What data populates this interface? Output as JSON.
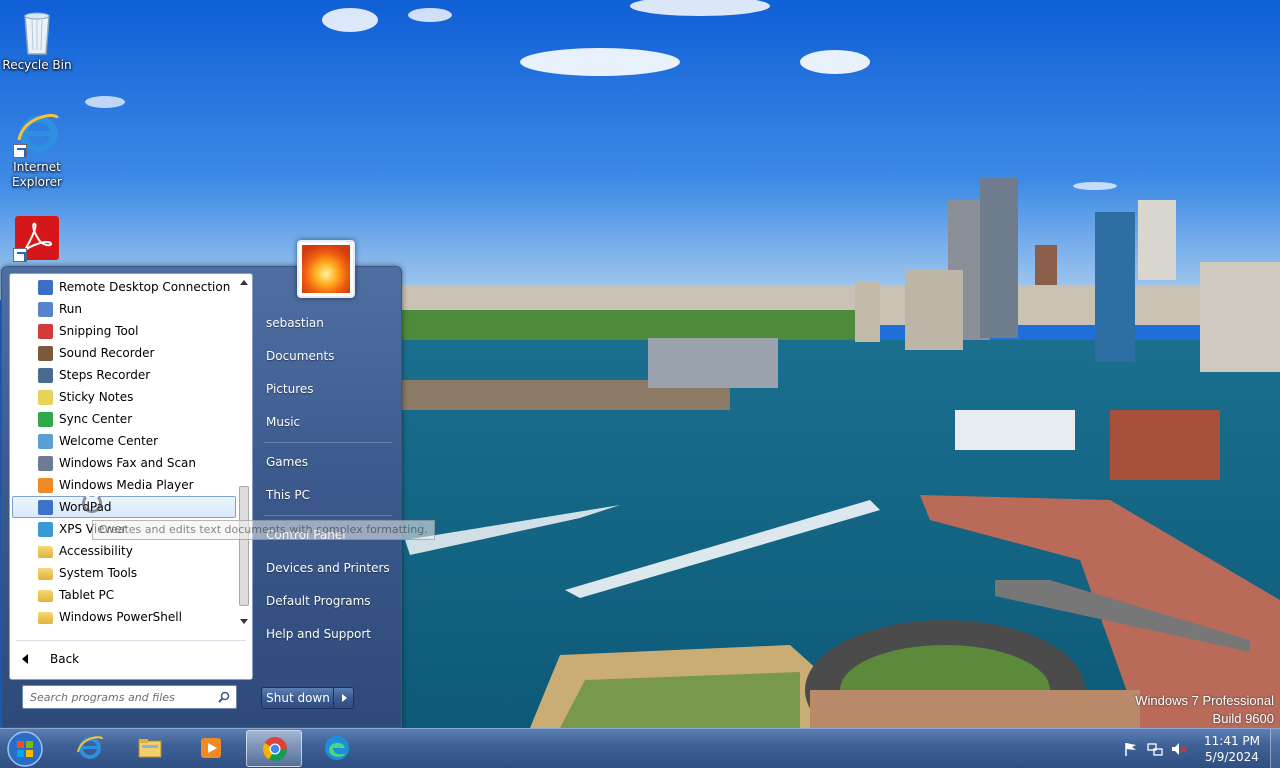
{
  "desktop": {
    "icons": [
      {
        "label": "Recycle Bin",
        "icon": "recycle-bin-icon"
      },
      {
        "label": "Internet Explorer",
        "icon": "internet-explorer-icon"
      },
      {
        "label": "",
        "icon": "adobe-acrobat-icon"
      }
    ],
    "watermark": {
      "line1": "Windows 7 Professional",
      "line2": "Build 9600"
    }
  },
  "start_menu": {
    "programs": [
      {
        "label": "Remote Desktop Connection",
        "icon": "remote-desktop-icon",
        "color": "#3b6fc4"
      },
      {
        "label": "Run",
        "icon": "run-icon",
        "color": "#5a84c9"
      },
      {
        "label": "Snipping Tool",
        "icon": "scissors-icon",
        "color": "#d23b3b"
      },
      {
        "label": "Sound Recorder",
        "icon": "microphone-icon",
        "color": "#7a5a3a"
      },
      {
        "label": "Steps Recorder",
        "icon": "steps-recorder-icon",
        "color": "#4a6a8f"
      },
      {
        "label": "Sticky Notes",
        "icon": "sticky-notes-icon",
        "color": "#e6d35a"
      },
      {
        "label": "Sync Center",
        "icon": "sync-center-icon",
        "color": "#2fa84a"
      },
      {
        "label": "Welcome Center",
        "icon": "welcome-center-icon",
        "color": "#5aa0d8"
      },
      {
        "label": "Windows Fax and Scan",
        "icon": "fax-scan-icon",
        "color": "#6b7c93"
      },
      {
        "label": "Windows Media Player",
        "icon": "media-player-icon",
        "color": "#f08a24"
      },
      {
        "label": "WordPad",
        "icon": "wordpad-icon",
        "color": "#3a73c8"
      },
      {
        "label": "XPS Viewer",
        "icon": "xps-viewer-icon",
        "color": "#3a9ad8"
      },
      {
        "label": "Accessibility",
        "icon": "folder-icon",
        "color": "#e8c45a"
      },
      {
        "label": "System Tools",
        "icon": "folder-icon",
        "color": "#e8c45a"
      },
      {
        "label": "Tablet PC",
        "icon": "folder-icon",
        "color": "#e8c45a"
      },
      {
        "label": "Windows PowerShell",
        "icon": "folder-icon",
        "color": "#e8c45a"
      }
    ],
    "selected_index": 10,
    "tooltip": "Creates and edits text documents with complex formatting.",
    "back_label": "Back",
    "search_placeholder": "Search programs and files",
    "right_items": [
      {
        "label": "sebastian",
        "group": 1
      },
      {
        "label": "Documents",
        "group": 1
      },
      {
        "label": "Pictures",
        "group": 1
      },
      {
        "label": "Music",
        "group": 1
      },
      {
        "label": "Games",
        "group": 2
      },
      {
        "label": "This PC",
        "group": 2
      },
      {
        "label": "Control Panel",
        "group": 3
      },
      {
        "label": "Devices and Printers",
        "group": 3
      },
      {
        "label": "Default Programs",
        "group": 3
      },
      {
        "label": "Help and Support",
        "group": 3
      }
    ],
    "shutdown_label": "Shut down"
  },
  "taskbar": {
    "pinned": [
      {
        "name": "internet-explorer",
        "icon": "internet-explorer-icon",
        "active": false
      },
      {
        "name": "file-explorer",
        "icon": "file-explorer-icon",
        "active": false
      },
      {
        "name": "media-player",
        "icon": "media-player-icon",
        "active": false
      },
      {
        "name": "chrome",
        "icon": "chrome-icon",
        "active": true
      },
      {
        "name": "edge",
        "icon": "edge-icon",
        "active": false
      }
    ],
    "tray_icons": [
      "action-center-flag-icon",
      "network-icon",
      "volume-muted-icon"
    ],
    "clock_time": "11:41 PM",
    "clock_date": "5/9/2024"
  }
}
